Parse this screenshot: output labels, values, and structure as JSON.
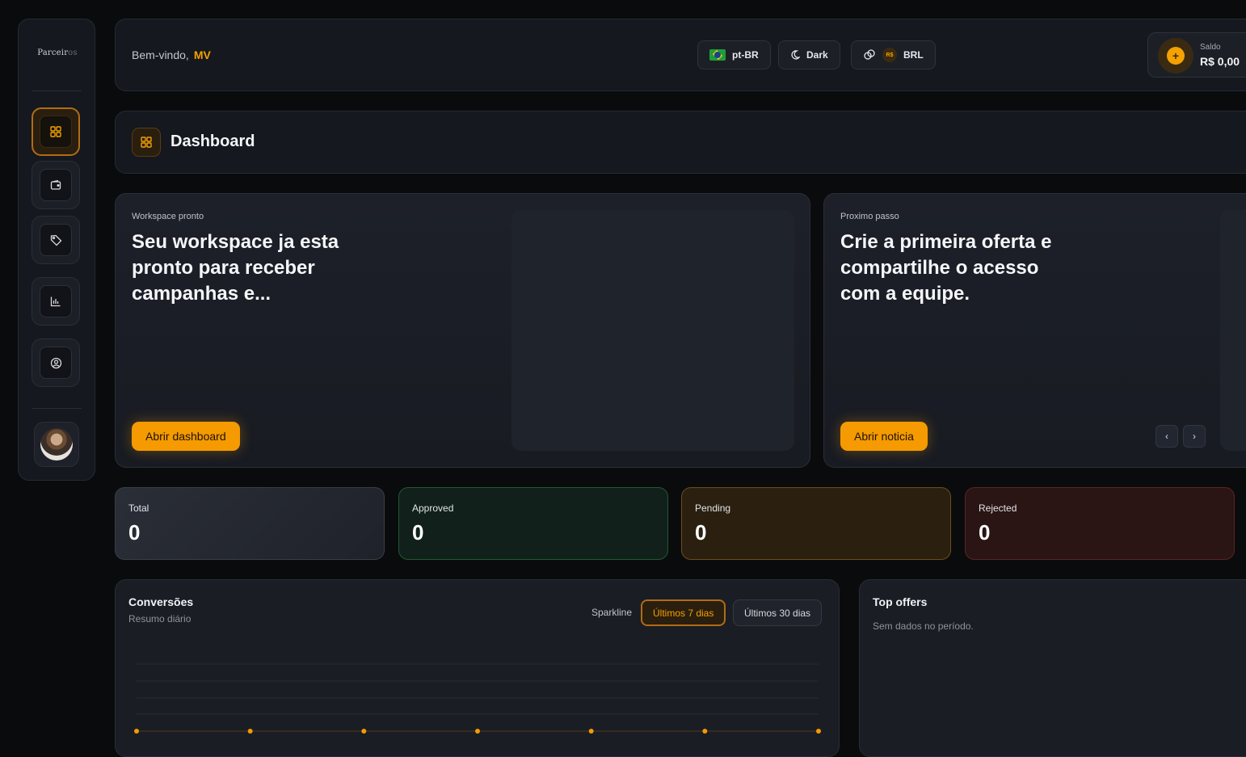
{
  "sidebar": {
    "logo_main": "Parceir",
    "logo_fade": "os",
    "nav": [
      {
        "icon": "grid-icon",
        "active": true
      },
      {
        "icon": "wallet-icon",
        "active": false
      },
      {
        "icon": "tag-icon",
        "active": false
      },
      {
        "icon": "bar-chart-icon",
        "active": false
      },
      {
        "icon": "user-circle-icon",
        "active": false
      }
    ]
  },
  "header": {
    "welcome": "Bem-vindo,",
    "user": "MV",
    "language": "pt-BR",
    "theme": "Dark",
    "currency_badge": "R$",
    "currency": "BRL",
    "balance_label": "Saldo",
    "balance_value": "R$ 0,00"
  },
  "page": {
    "title": "Dashboard"
  },
  "hero_cards": [
    {
      "eyebrow": "Workspace pronto",
      "headline": "Seu workspace ja esta pronto para receber campanhas e...",
      "cta": "Abrir dashboard"
    },
    {
      "eyebrow": "Proximo passo",
      "headline": "Crie a primeira oferta e compartilhe o acesso com a equipe.",
      "cta": "Abrir noticia"
    }
  ],
  "stats": [
    {
      "label": "Total",
      "value": "0"
    },
    {
      "label": "Approved",
      "value": "0"
    },
    {
      "label": "Pending",
      "value": "0"
    },
    {
      "label": "Rejected",
      "value": "0"
    }
  ],
  "conversions": {
    "title": "Conversões",
    "subtitle": "Resumo diário",
    "sparkline_label": "Sparkline",
    "range_7": "Últimos 7 dias",
    "range_30": "Últimos 30 dias"
  },
  "top_offers": {
    "title": "Top offers",
    "empty": "Sem dados no período."
  },
  "colors": {
    "accent": "#f59a00",
    "approved": "#1f5a33",
    "pending": "#6b4d1b",
    "rejected": "#5c2424"
  },
  "chart_data": {
    "type": "line",
    "title": "Conversões",
    "subtitle": "Resumo diário",
    "x": [
      1,
      2,
      3,
      4,
      5,
      6,
      7
    ],
    "series": [
      {
        "values": [
          0,
          0,
          0,
          0,
          0,
          0,
          0
        ]
      }
    ],
    "grid": true
  }
}
